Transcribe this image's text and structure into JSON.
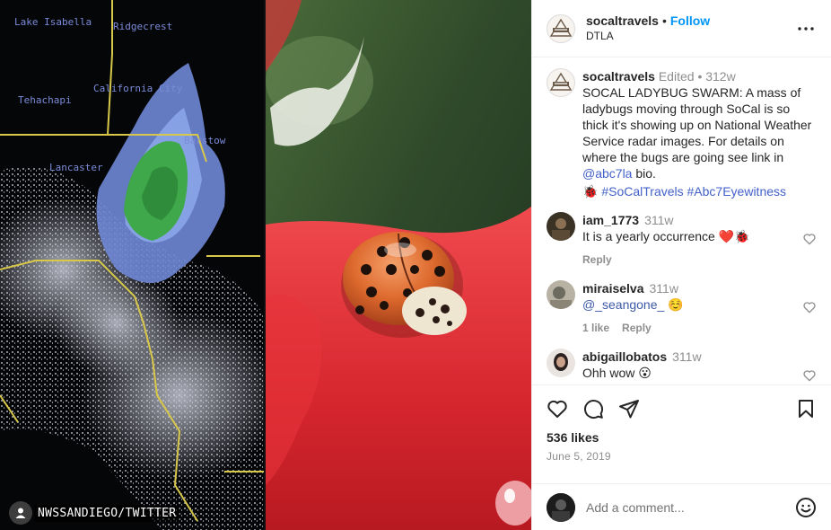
{
  "media": {
    "credit": "NWSSANDIEGO/TWITTER",
    "radar_labels": {
      "lake_isabella": "Lake Isabella",
      "ridgecrest": "Ridgecrest",
      "tehachapi": "Tehachapi",
      "california_city": "California City",
      "barstow": "Barstow",
      "lancaster": "Lancaster"
    }
  },
  "header": {
    "username": "socaltravels",
    "separator": "•",
    "follow_label": "Follow",
    "location": "DTLA"
  },
  "caption": {
    "username": "socaltravels",
    "edited": "Edited",
    "bullet": "•",
    "time": "312w",
    "text": "SOCAL LADYBUG SWARM: A mass of ladybugs moving through SoCal is so thick it's showing up on National Weather Service radar images. For details on where the bugs are going see link in ",
    "mention": "@abc7la",
    "text_after": " bio.",
    "emoji": "🐞",
    "hashtags": "#SoCalTravels #Abc7Eyewitness"
  },
  "comments": [
    {
      "username": "iam_1773",
      "time": "311w",
      "text": "It is a yearly occurrence ❤️🐞",
      "likes": "",
      "reply": "Reply"
    },
    {
      "username": "miraiselva",
      "time": "311w",
      "text": "@_seangone_ ☺️",
      "likes": "1 like",
      "reply": "Reply"
    },
    {
      "username": "abigaillobatos",
      "time": "311w",
      "text": "Ohh wow 😮",
      "likes": "",
      "reply": ""
    }
  ],
  "footer": {
    "likes": "536 likes",
    "date": "June 5, 2019",
    "comment_placeholder": "Add a comment..."
  },
  "colors": {
    "accent": "#0095f6",
    "hashtag": "#4361c9",
    "muted": "#8e8e8e"
  }
}
